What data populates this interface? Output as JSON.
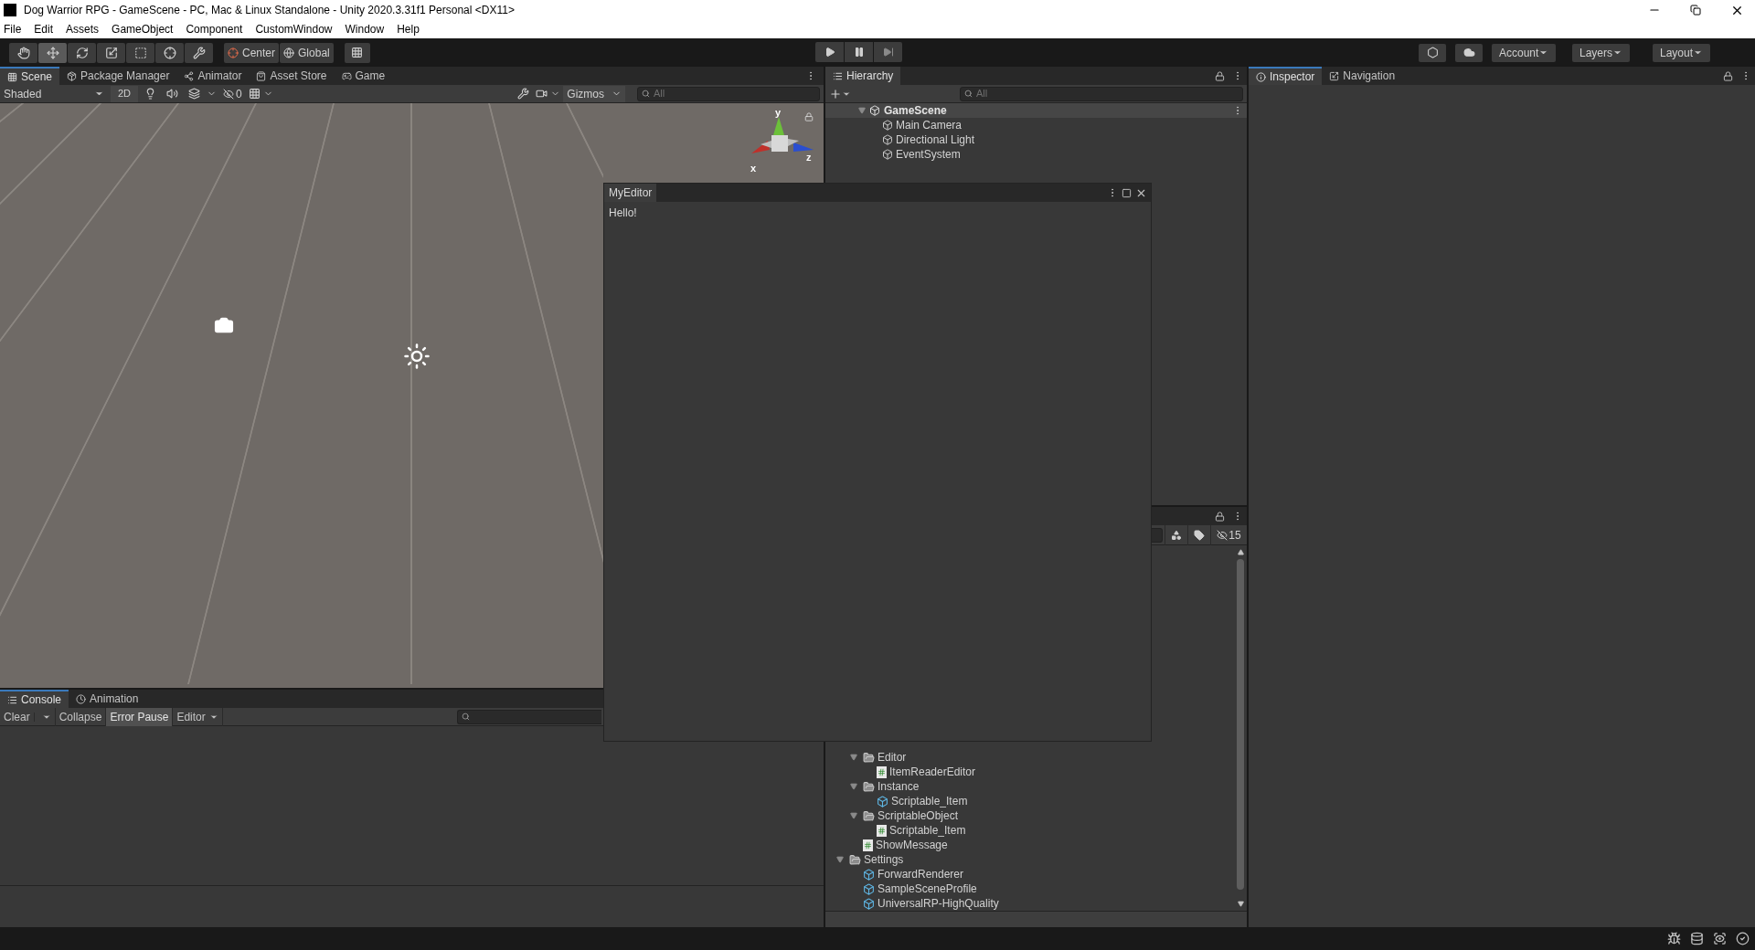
{
  "window": {
    "title": "Dog Warrior RPG - GameScene - PC, Mac & Linux Standalone - Unity 2020.3.31f1 Personal <DX11>"
  },
  "menu": [
    "File",
    "Edit",
    "Assets",
    "GameObject",
    "Component",
    "CustomWindow",
    "Window",
    "Help"
  ],
  "toolbar": {
    "tools": [
      {
        "kind": "hand",
        "selected": false
      },
      {
        "kind": "move",
        "selected": true
      },
      {
        "kind": "rotate",
        "selected": false
      },
      {
        "kind": "scale",
        "selected": false
      },
      {
        "kind": "rect",
        "selected": false
      },
      {
        "kind": "transform",
        "selected": false
      },
      {
        "kind": "custom",
        "selected": false
      }
    ],
    "pivot": "Center",
    "space": "Global",
    "account": "Account",
    "layers": "Layers",
    "layout": "Layout"
  },
  "scene_panel": {
    "tabs": [
      {
        "label": "Scene",
        "kind": "scene",
        "selected": true
      },
      {
        "label": "Package Manager",
        "kind": "package",
        "selected": false
      },
      {
        "label": "Animator",
        "kind": "animator",
        "selected": false
      },
      {
        "label": "Asset Store",
        "kind": "store",
        "selected": false
      },
      {
        "label": "Game",
        "kind": "game",
        "selected": false
      }
    ],
    "shading": "Shaded",
    "mode_2d": "2D",
    "hidden_count": "0",
    "gizmos": "Gizmos",
    "search_placeholder": "All",
    "axis_labels": {
      "y": "y",
      "x": "x",
      "z": "z"
    }
  },
  "hierarchy": {
    "title": "Hierarchy",
    "search_placeholder": "All",
    "scene": "GameScene",
    "items": [
      "Main Camera",
      "Directional Light",
      "EventSystem"
    ]
  },
  "inspector_tabs": [
    {
      "label": "Inspector",
      "kind": "info",
      "selected": true
    },
    {
      "label": "Navigation",
      "kind": "navigation",
      "selected": false
    }
  ],
  "console": {
    "tabs": [
      {
        "label": "Console",
        "kind": "console",
        "selected": true
      },
      {
        "label": "Animation",
        "kind": "animation",
        "selected": false
      }
    ],
    "buttons": [
      {
        "label": "Clear",
        "kind": "split",
        "on": false
      },
      {
        "label": "Collapse",
        "kind": "toggle",
        "on": false
      },
      {
        "label": "Error Pause",
        "kind": "toggle",
        "on": true
      },
      {
        "label": "Editor",
        "kind": "dropdown",
        "on": false
      }
    ]
  },
  "project": {
    "hidden_count": "15",
    "tree": [
      {
        "kind": "continued",
        "children": [
          {
            "label": "Editor",
            "kind": "folder",
            "expanded": true,
            "children": [
              {
                "label": "ItemReaderEditor",
                "kind": "script"
              }
            ]
          },
          {
            "label": "Instance",
            "kind": "folder",
            "expanded": true,
            "children": [
              {
                "label": "Scriptable_Item",
                "kind": "asset"
              }
            ]
          },
          {
            "label": "ScriptableObject",
            "kind": "folder",
            "expanded": true,
            "children": [
              {
                "label": "Scriptable_Item",
                "kind": "script"
              }
            ]
          },
          {
            "label": "ShowMessage",
            "kind": "script"
          }
        ]
      },
      {
        "label": "Settings",
        "kind": "folder",
        "expanded": true,
        "children": [
          {
            "label": "ForwardRenderer",
            "kind": "asset"
          },
          {
            "label": "SampleSceneProfile",
            "kind": "asset"
          },
          {
            "label": "UniversalRP-HighQuality",
            "kind": "asset"
          }
        ]
      }
    ]
  },
  "floating_window": {
    "title": "MyEditor",
    "text": "Hello!"
  }
}
